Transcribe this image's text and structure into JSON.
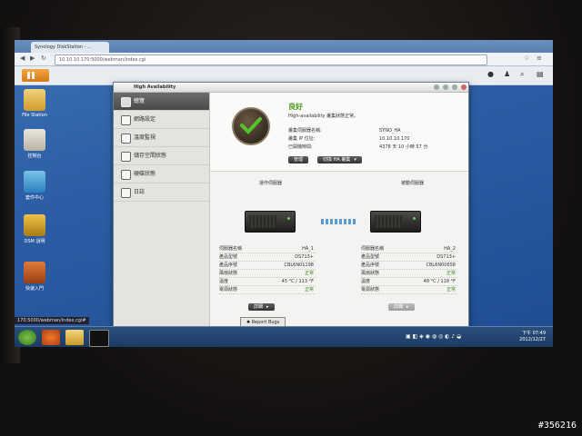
{
  "browser": {
    "tab_title": "Synology DiskStation - ...",
    "url": "10.10.10.170:5000/webman/index.cgi",
    "status_url": "170:5000/webman/index.cgi#"
  },
  "desktop_icons": [
    {
      "label": "File Station"
    },
    {
      "label": "控制台"
    },
    {
      "label": "套件中心"
    },
    {
      "label": "DSM 說明"
    },
    {
      "label": "快速入門"
    }
  ],
  "window": {
    "title": "High Availability",
    "sidebar": [
      {
        "label": "總覽",
        "active": true
      },
      {
        "label": "網路設定",
        "active": false
      },
      {
        "label": "溫度監視",
        "active": false
      },
      {
        "label": "儲存空間狀態",
        "active": false
      },
      {
        "label": "硬碟狀態",
        "active": false
      },
      {
        "label": "日誌",
        "active": false
      }
    ],
    "status": {
      "title": "良好",
      "description": "High-availability 叢集狀態正常。",
      "server_name_label": "叢集伺服器名稱:",
      "server_name_value": "SYNO_HA",
      "ip_label": "叢集 IP 位址:",
      "ip_value": "10.10.10.170",
      "uptime_label": "已開機時間:",
      "uptime_value": "4378 天 10 小時 57 分"
    },
    "buttons": {
      "manage": "管理",
      "switch": "切換 HA 叢集"
    },
    "active_server": {
      "heading": "運作伺服器",
      "rows": [
        {
          "k": "伺服器名稱",
          "v": "HA_1",
          "green": false
        },
        {
          "k": "產品型號",
          "v": "DS713+",
          "green": false
        },
        {
          "k": "產品序號",
          "v": "CBL6N01198",
          "green": false
        },
        {
          "k": "風扇狀態",
          "v": "正常",
          "green": true
        },
        {
          "k": "溫度",
          "v": "45 °C / 113 °F",
          "green": false
        },
        {
          "k": "電源狀態",
          "v": "正常",
          "green": true
        }
      ],
      "details_button": "詳細"
    },
    "passive_server": {
      "heading": "被動伺服器",
      "rows": [
        {
          "k": "伺服器名稱",
          "v": "HA_2",
          "green": false
        },
        {
          "k": "產品型號",
          "v": "DS713+",
          "green": false
        },
        {
          "k": "產品序號",
          "v": "CBL6N00658",
          "green": false
        },
        {
          "k": "風扇狀態",
          "v": "正常",
          "green": true
        },
        {
          "k": "溫度",
          "v": "48 °C / 118 °F",
          "green": false
        },
        {
          "k": "電源狀態",
          "v": "正常",
          "green": true
        }
      ],
      "details_button": "詳細"
    }
  },
  "report_bugs": "Report Bugs",
  "clock": {
    "time": "下午 07:49",
    "date": "2012/12/27"
  },
  "watermark": "#356216",
  "colors": {
    "ok_green": "#4a9a1e",
    "accent_orange": "#e08a2a"
  }
}
